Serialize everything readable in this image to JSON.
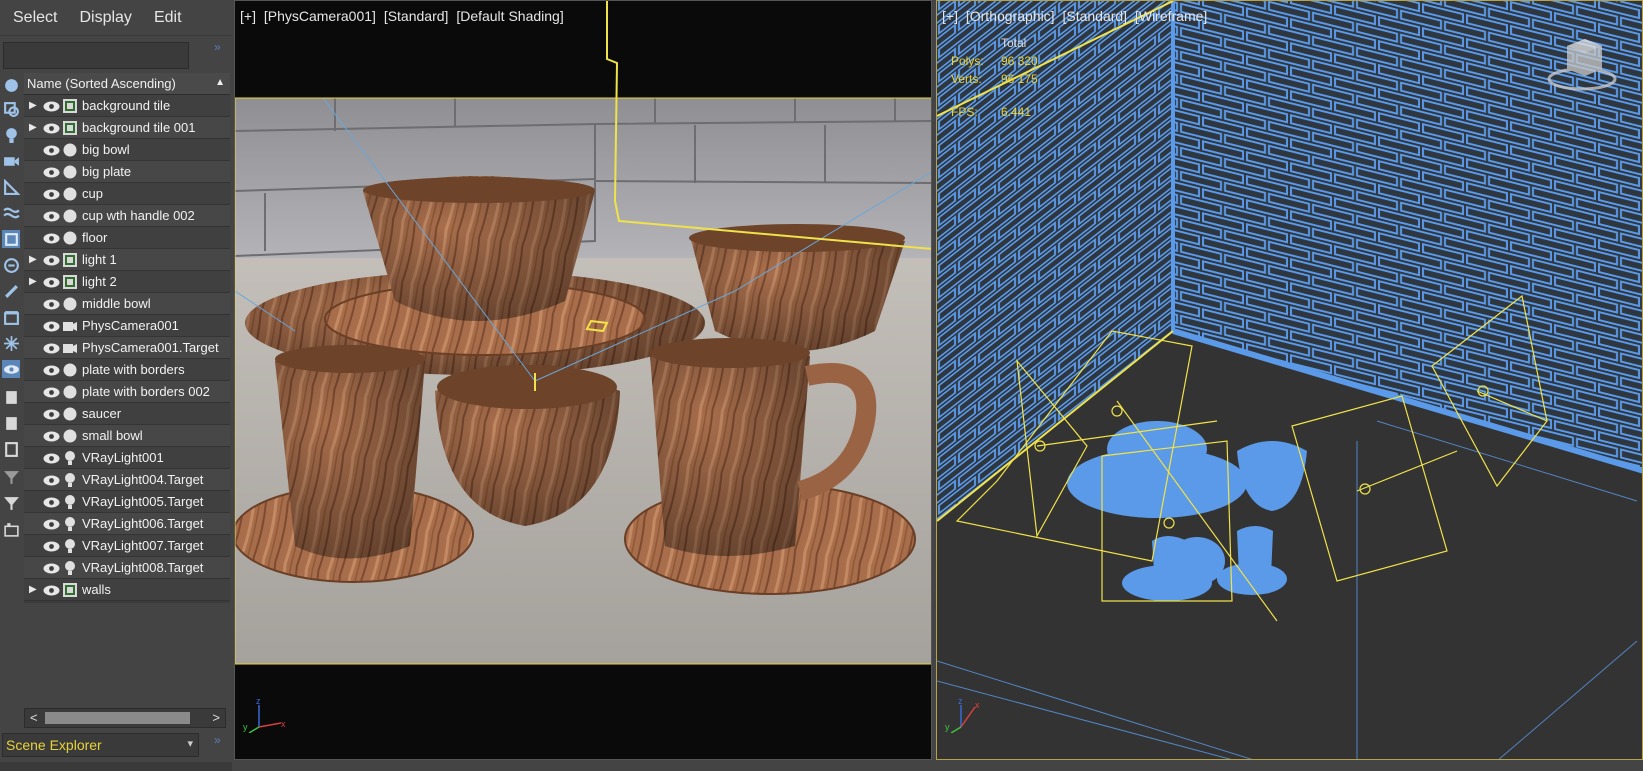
{
  "menu": {
    "select": "Select",
    "display": "Display",
    "edit": "Edit"
  },
  "search": {
    "placeholder": ""
  },
  "tree": {
    "header": "Name (Sorted Ascending)",
    "rows": [
      {
        "name": "background tile",
        "kind": "group-icon",
        "expandable": true
      },
      {
        "name": "background tile 001",
        "kind": "group-icon",
        "expandable": true
      },
      {
        "name": "big bowl",
        "kind": "geometry-icon",
        "expandable": false
      },
      {
        "name": "big plate",
        "kind": "geometry-icon",
        "expandable": false
      },
      {
        "name": "cup",
        "kind": "geometry-icon",
        "expandable": false
      },
      {
        "name": "cup wth handle 002",
        "kind": "geometry-icon",
        "expandable": false
      },
      {
        "name": "floor",
        "kind": "geometry-icon",
        "expandable": false
      },
      {
        "name": "light 1",
        "kind": "group-icon",
        "expandable": true
      },
      {
        "name": "light 2",
        "kind": "group-icon",
        "expandable": true
      },
      {
        "name": "middle bowl",
        "kind": "geometry-icon",
        "expandable": false
      },
      {
        "name": "PhysCamera001",
        "kind": "camera-icon",
        "expandable": false
      },
      {
        "name": "PhysCamera001.Target",
        "kind": "camera-icon",
        "expandable": false
      },
      {
        "name": "plate with borders",
        "kind": "geometry-icon",
        "expandable": false
      },
      {
        "name": "plate with borders 002",
        "kind": "geometry-icon",
        "expandable": false
      },
      {
        "name": "saucer",
        "kind": "geometry-icon",
        "expandable": false
      },
      {
        "name": "small bowl",
        "kind": "geometry-icon",
        "expandable": false
      },
      {
        "name": "VRayLight001",
        "kind": "light-icon",
        "expandable": false
      },
      {
        "name": "VRayLight004.Target",
        "kind": "light-icon",
        "expandable": false
      },
      {
        "name": "VRayLight005.Target",
        "kind": "light-icon",
        "expandable": false
      },
      {
        "name": "VRayLight006.Target",
        "kind": "light-icon",
        "expandable": false
      },
      {
        "name": "VRayLight007.Target",
        "kind": "light-icon",
        "expandable": false
      },
      {
        "name": "VRayLight008.Target",
        "kind": "light-icon",
        "expandable": false
      },
      {
        "name": "walls",
        "kind": "group-icon",
        "expandable": true
      }
    ]
  },
  "explorer_dropdown": {
    "value": "Scene Explorer"
  },
  "viewport_camera": {
    "label_parts": [
      "[+]",
      "[PhysCamera001]",
      "[Standard]",
      "[Default Shading]"
    ]
  },
  "viewport_ortho": {
    "label_parts": [
      "[+]",
      "[Orthographic]",
      "[Standard]",
      "[Wireframe]"
    ],
    "stats": {
      "header": "Total",
      "polys_label": "Polys:",
      "polys_value": "96 320",
      "verts_label": "Verts:",
      "verts_value": "96 175",
      "fps_label": "FPS:",
      "fps_value": "6.441"
    }
  },
  "colors": {
    "wood": "#a06848",
    "wire_blue": "#5b9ae8",
    "selection_yellow": "#e8d23a",
    "panel_bg": "#444444"
  }
}
